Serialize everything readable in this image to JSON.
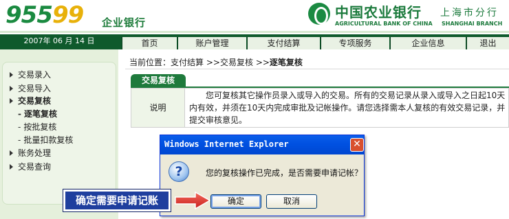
{
  "brand": {
    "logo_num_a": "955",
    "logo_num_b": "99",
    "logo_sub": "企业银行",
    "bank_name_cn": "中国农业银行",
    "bank_branch_cn": "上海市分行",
    "bank_name_en": "AGRICULTURAL BANK OF CHINA",
    "bank_branch_en": "SHANGHAI BRANCH",
    "emblem_icon": "abc-bank-emblem-icon",
    "brand_color": "#1b7a3c"
  },
  "date": {
    "year": "2007",
    "year_unit": "年",
    "month": "06",
    "month_unit": "月",
    "day": "14",
    "day_unit": "日"
  },
  "nav": {
    "tabs": [
      {
        "label": "首页"
      },
      {
        "label": "账户管理"
      },
      {
        "label": "支付结算"
      },
      {
        "label": "专项服务"
      },
      {
        "label": "企业信息"
      },
      {
        "label": "退出"
      }
    ]
  },
  "sidebar": {
    "items": [
      {
        "label": "交易录入",
        "level": 1
      },
      {
        "label": "交易导入",
        "level": 1
      },
      {
        "label": "交易复核",
        "level": 1,
        "active": true
      },
      {
        "label": "逐笔复核",
        "level": 2,
        "active": true
      },
      {
        "label": "按批复核",
        "level": 2
      },
      {
        "label": "批量扣款复核",
        "level": 2
      },
      {
        "label": "账务处理",
        "level": 1
      },
      {
        "label": "交易查询",
        "level": 1
      }
    ]
  },
  "breadcrumb": {
    "prefix": "当前位置：",
    "path1": "支付结算",
    "sep1": ">>",
    "path2": "交易复核",
    "sep2": ">>",
    "current": "逐笔复核"
  },
  "content": {
    "tab_title": "交易复核",
    "info_label": "说明",
    "info_text": "您可复核其它操作员录入或导入的交易。所有的交易记录从录入或导入之日起10天内有效，并须在10天内完成审批及记帐操作。请您选择需本人复核的有效交易记录，并提交审核意见。"
  },
  "dialog": {
    "title": "Windows Internet Explorer",
    "close_icon": "close-icon",
    "question_icon": "question-icon",
    "message": "您的复核操作已完成，是否需要申请记帐？",
    "ok_label": "确定",
    "cancel_label": "取消"
  },
  "annotation": {
    "callout_text": "确定需要申请记账",
    "arrow_icon": "arrow-right-icon",
    "arrow_color": "#e8322e"
  }
}
